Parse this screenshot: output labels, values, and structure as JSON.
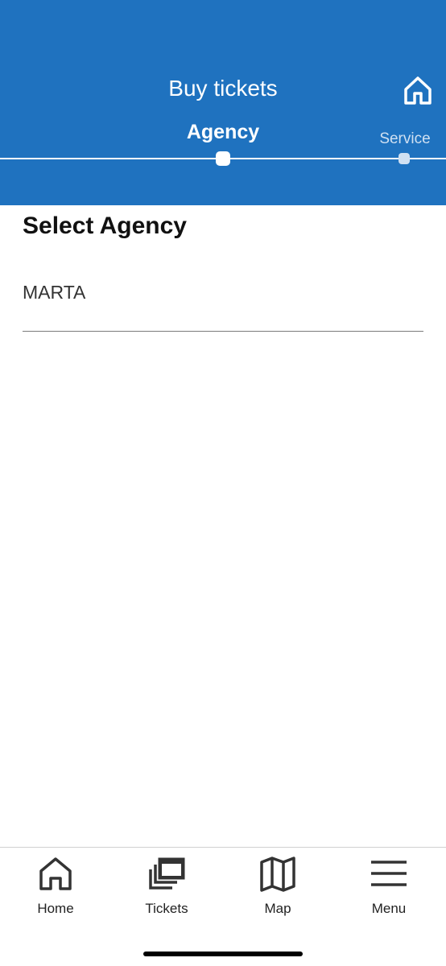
{
  "header": {
    "title": "Buy tickets",
    "home_icon": "home-icon",
    "steps": [
      {
        "label": "Agency",
        "active": true
      },
      {
        "label": "Service",
        "active": false
      }
    ]
  },
  "main": {
    "section_title": "Select Agency",
    "agency_value": "MARTA"
  },
  "tabbar": {
    "items": [
      {
        "label": "Home",
        "icon": "home-icon"
      },
      {
        "label": "Tickets",
        "icon": "tickets-icon"
      },
      {
        "label": "Map",
        "icon": "map-icon"
      },
      {
        "label": "Menu",
        "icon": "menu-icon"
      }
    ]
  },
  "colors": {
    "header_bg": "#1f72bf",
    "inactive_step": "#cfe0f2"
  }
}
